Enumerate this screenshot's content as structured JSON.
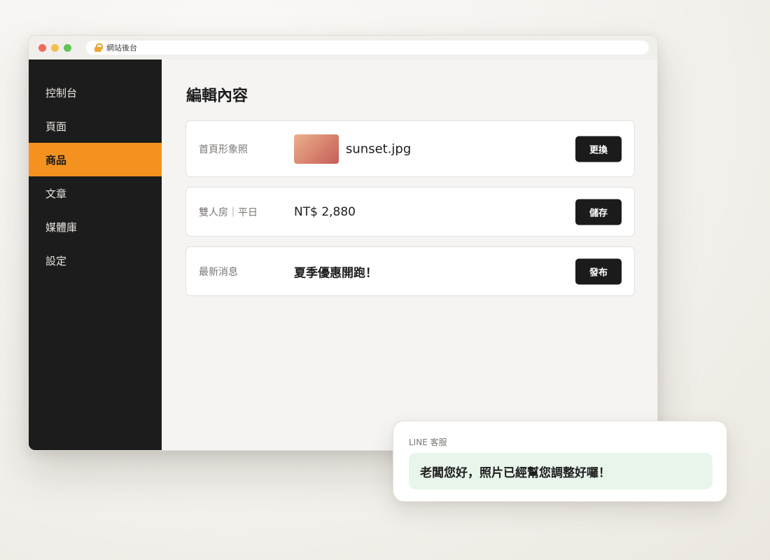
{
  "browser": {
    "address": "網站後台"
  },
  "sidebar": {
    "items": [
      {
        "label": "控制台"
      },
      {
        "label": "頁面"
      },
      {
        "label": "商品"
      },
      {
        "label": "文章"
      },
      {
        "label": "媒體庫"
      },
      {
        "label": "設定"
      }
    ],
    "active_index": 2
  },
  "main": {
    "title": "編輯內容",
    "cards": [
      {
        "label": "首頁形象照",
        "value": "sunset.jpg",
        "button": "更換"
      },
      {
        "label": "雙人房｜平日",
        "value": "NT$ 2,880",
        "button": "儲存"
      },
      {
        "label": "最新消息",
        "value": "夏季優惠開跑！",
        "button": "發布"
      }
    ]
  },
  "chat": {
    "title": "LINE 客服",
    "message": "老闆您好，照片已經幫您調整好囉！"
  },
  "colors": {
    "accent": "#f5921f",
    "sidebar_bg": "#1c1c1c",
    "button_bg": "#1b1b1b",
    "chat_bubble": "#e8f5ea"
  }
}
